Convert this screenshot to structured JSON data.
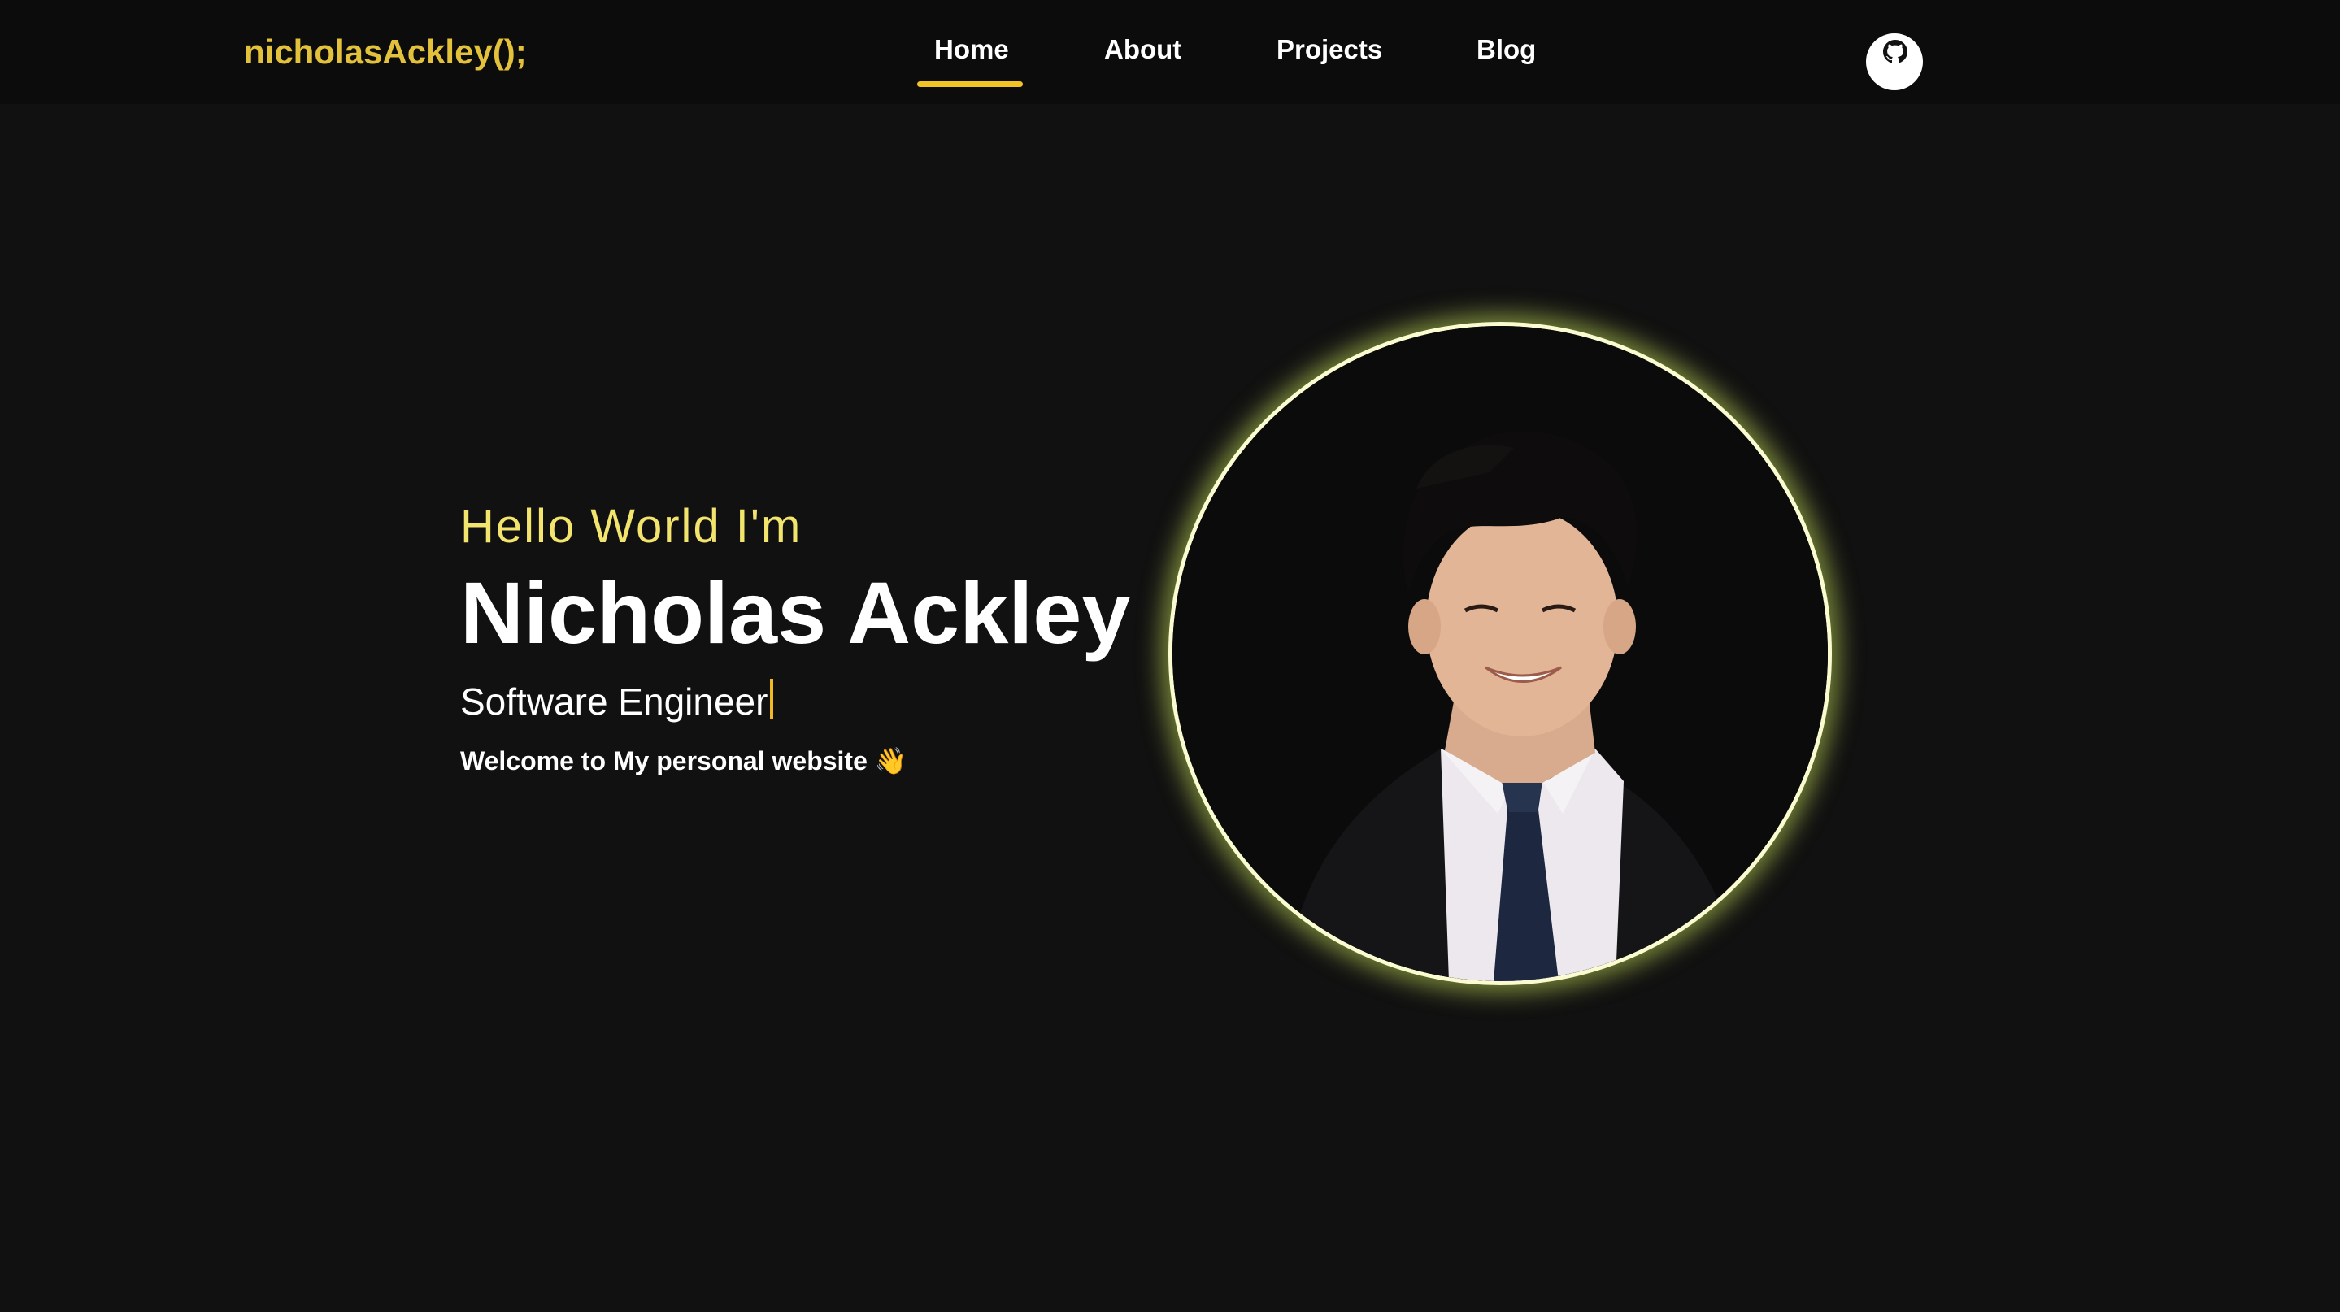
{
  "nav": {
    "brand": "nicholasAckley();",
    "links": [
      {
        "label": "Home",
        "active": true
      },
      {
        "label": "About",
        "active": false
      },
      {
        "label": "Projects",
        "active": false
      },
      {
        "label": "Blog",
        "active": false
      }
    ],
    "github_icon": "github-icon"
  },
  "hero": {
    "greeting": "Hello World I'm",
    "name": "Nicholas Ackley",
    "role": "Software Engineer",
    "welcome": "Welcome to My personal website 👋",
    "portrait_icon": "profile-photo"
  },
  "colors": {
    "background": "#111111",
    "navbar": "#0c0c0c",
    "brand": "#e3c13b",
    "greeting": "#f2e46c",
    "accent": "#f1c326",
    "ring": "#fafbd0"
  }
}
